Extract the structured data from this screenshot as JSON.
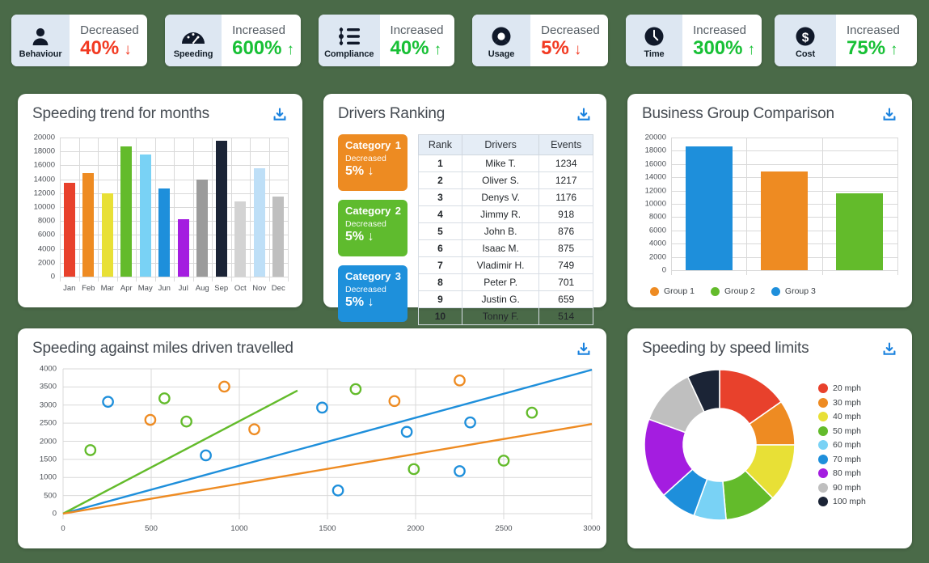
{
  "theme": {
    "background": "#4a6a48",
    "card": "#ffffff",
    "icon_pane": "#dde7f2",
    "up_color": "#17c035",
    "down_color": "#f23a22",
    "accent_blue": "#1a73d4"
  },
  "kpis": [
    {
      "icon": "person-icon",
      "label": "Behaviour",
      "trend": "Decreased",
      "value": "40%",
      "arrow": "↓",
      "direction": "down"
    },
    {
      "icon": "speedometer-icon",
      "label": "Speeding",
      "trend": "Increased",
      "value": "600%",
      "arrow": "↑",
      "direction": "up"
    },
    {
      "icon": "checklist-icon",
      "label": "Compliance",
      "trend": "Increased",
      "value": "40%",
      "arrow": "↑",
      "direction": "up"
    },
    {
      "icon": "piechart-icon",
      "label": "Usage",
      "trend": "Decreased",
      "value": "5%",
      "arrow": "↓",
      "direction": "down"
    },
    {
      "icon": "clock-icon",
      "label": "Time",
      "trend": "Increased",
      "value": "300%",
      "arrow": "↑",
      "direction": "up"
    },
    {
      "icon": "dollar-icon",
      "label": "Cost",
      "trend": "Increased",
      "value": "75%",
      "arrow": "↑",
      "direction": "up"
    }
  ],
  "panels": {
    "speeding_trend": {
      "title": "Speeding trend for months",
      "download_label": "Download"
    },
    "drivers_ranking": {
      "title": "Drivers Ranking",
      "download_label": "Download"
    },
    "business_group": {
      "title": "Business Group Comparison",
      "download_label": "Download"
    },
    "speeding_miles": {
      "title": "Speeding against miles driven travelled",
      "download_label": "Download"
    },
    "speed_limits": {
      "title": "Speeding by speed limits",
      "download_label": "Download"
    }
  },
  "drivers_ranking": {
    "categories": [
      {
        "name": "Category",
        "index": "1",
        "trend": "Decreased",
        "value": "5%",
        "arrow": "↓",
        "color": "#ED8B22"
      },
      {
        "name": "Category",
        "index": "2",
        "trend": "Decreased",
        "value": "5%",
        "arrow": "↓",
        "color": "#5FBB2E"
      },
      {
        "name": "Category",
        "index": "3",
        "trend": "Decreased",
        "value": "5%",
        "arrow": "↓",
        "color": "#1E90DB"
      }
    ],
    "columns": [
      "Rank",
      "Drivers",
      "Events"
    ],
    "rows": [
      {
        "rank": "1",
        "driver": "Mike T.",
        "events": "1234"
      },
      {
        "rank": "2",
        "driver": "Oliver S.",
        "events": "1217"
      },
      {
        "rank": "3",
        "driver": "Denys V.",
        "events": "1176"
      },
      {
        "rank": "4",
        "driver": "Jimmy R.",
        "events": "918"
      },
      {
        "rank": "5",
        "driver": "John B.",
        "events": "876"
      },
      {
        "rank": "6",
        "driver": "Isaac M.",
        "events": "875"
      },
      {
        "rank": "7",
        "driver": "Vladimir H.",
        "events": "749"
      },
      {
        "rank": "8",
        "driver": "Peter P.",
        "events": "701"
      },
      {
        "rank": "9",
        "driver": "Justin G.",
        "events": "659"
      },
      {
        "rank": "10",
        "driver": "Tonny F.",
        "events": "514"
      }
    ]
  },
  "chart_data": [
    {
      "id": "speeding_trend",
      "type": "bar",
      "title": "Speeding trend for months",
      "xlabel": "",
      "ylabel": "",
      "ylim": [
        0,
        20000
      ],
      "yticks": [
        0,
        2000,
        4000,
        6000,
        8000,
        10000,
        12000,
        14000,
        16000,
        18000,
        20000
      ],
      "grid": true,
      "categories": [
        "Jan",
        "Feb",
        "Mar",
        "Apr",
        "May",
        "Jun",
        "Jul",
        "Aug",
        "Sep",
        "Oct",
        "Nov",
        "Dec"
      ],
      "values": [
        13500,
        14900,
        11950,
        18700,
        17550,
        12650,
        8300,
        14000,
        19500,
        10800,
        15550,
        11550
      ],
      "colors": [
        "#E8412C",
        "#EE8B22",
        "#E8E036",
        "#63BB2B",
        "#79D2F5",
        "#1E8FDB",
        "#A41DE0",
        "#9B9B9B",
        "#1B2436",
        "#D3D3D3",
        "#BEDFF7",
        "#BFBFBF"
      ]
    },
    {
      "id": "business_group",
      "type": "bar",
      "title": "Business Group Comparison",
      "xlabel": "",
      "ylabel": "",
      "ylim": [
        0,
        20000
      ],
      "yticks": [
        0,
        2000,
        4000,
        6000,
        8000,
        10000,
        12000,
        14000,
        16000,
        18000,
        20000
      ],
      "grid": true,
      "categories": [
        "Group 3",
        "Group 1",
        "Group 2"
      ],
      "values": [
        18700,
        14900,
        11550
      ],
      "colors": [
        "#1E8FDB",
        "#EE8B22",
        "#63BB2B"
      ],
      "legend_position": "bottom",
      "legend": [
        {
          "label": "Group 1",
          "color": "#EE8B22"
        },
        {
          "label": "Group 2",
          "color": "#63BB2B"
        },
        {
          "label": "Group 3",
          "color": "#1E8FDB"
        }
      ]
    },
    {
      "id": "speeding_miles",
      "type": "scatter",
      "title": "Speeding against miles driven travelled",
      "xlabel": "",
      "ylabel": "",
      "xlim": [
        0,
        3000
      ],
      "ylim": [
        0,
        4000
      ],
      "xticks": [
        0,
        500,
        1000,
        1500,
        2000,
        2500,
        3000
      ],
      "yticks": [
        0,
        500,
        1000,
        1500,
        2000,
        2500,
        3000,
        3500,
        4000
      ],
      "grid": true,
      "series": [
        {
          "name": "Series blue",
          "color": "#1E8FDB",
          "points": [
            [
              255,
              3090
            ],
            [
              810,
              1610
            ],
            [
              1470,
              2930
            ],
            [
              1560,
              640
            ],
            [
              1950,
              2260
            ],
            [
              2250,
              1175
            ],
            [
              2310,
              2520
            ]
          ],
          "trendline": [
            [
              0,
              0
            ],
            [
              3000,
              3975
            ]
          ]
        },
        {
          "name": "Series green",
          "color": "#63BB2B",
          "points": [
            [
              155,
              1755
            ],
            [
              575,
              3185
            ],
            [
              700,
              2545
            ],
            [
              1660,
              3440
            ],
            [
              1990,
              1230
            ],
            [
              2500,
              1465
            ],
            [
              2660,
              2790
            ]
          ],
          "trendline": [
            [
              0,
              0
            ],
            [
              1330,
              3400
            ]
          ]
        },
        {
          "name": "Series orange",
          "color": "#EE8B22",
          "points": [
            [
              495,
              2590
            ],
            [
              915,
              3510
            ],
            [
              1085,
              2330
            ],
            [
              1880,
              3110
            ],
            [
              2250,
              3680
            ]
          ],
          "trendline": [
            [
              0,
              0
            ],
            [
              3000,
              2475
            ]
          ]
        }
      ]
    },
    {
      "id": "speed_limits",
      "type": "pie",
      "subtype": "donut",
      "title": "Speeding by speed limits",
      "legend_position": "right",
      "labels": [
        "20 mph",
        "30 mph",
        "40 mph",
        "50 mph",
        "60 mph",
        "70 mph",
        "80 mph",
        "90 mph",
        "100 mph"
      ],
      "values": [
        55,
        35,
        45,
        40,
        25,
        28,
        62,
        45,
        25
      ],
      "colors": [
        "#E8412C",
        "#EE8B22",
        "#E8E036",
        "#63BB2B",
        "#79D2F5",
        "#1E8FDB",
        "#A41DE0",
        "#BFBFBF",
        "#1B2436"
      ]
    }
  ]
}
